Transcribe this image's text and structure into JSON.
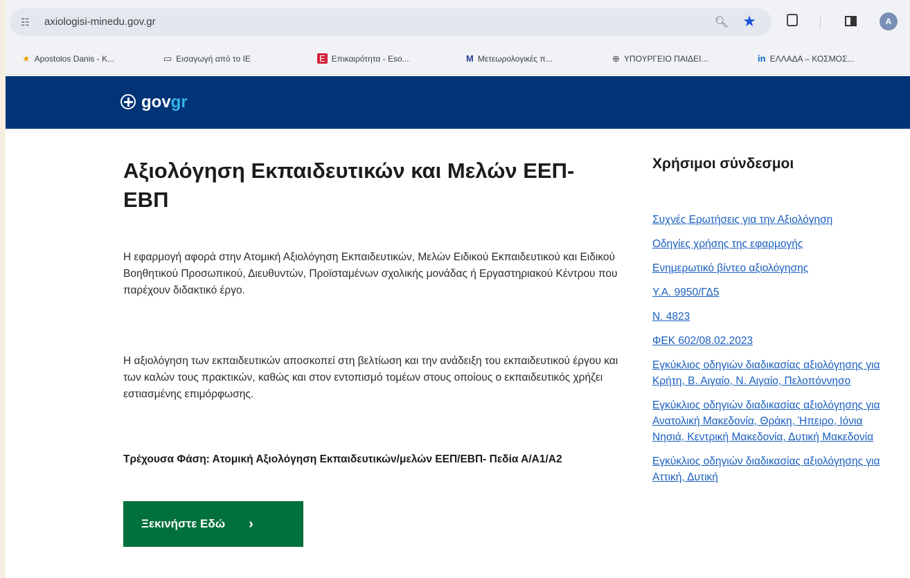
{
  "browser": {
    "url": "axiologisi-minedu.gov.gr",
    "profile_initial": "A",
    "bookmarks": [
      {
        "label": "Apostolos Danis - K...",
        "icon": "star-icon"
      },
      {
        "label": "Εισαγωγή από το IE",
        "icon": "folder-icon"
      },
      {
        "label": "Επικαιρότητα - Eso...",
        "icon": "eso-icon"
      },
      {
        "label": "Μετεωρολογικές π...",
        "icon": "meteo-icon"
      },
      {
        "label": "ΥΠΟΥΡΓΕΙΟ ΠΑΙΔΕΙ...",
        "icon": "ministry-icon"
      },
      {
        "label": "ΕΛΛΑΔΑ – ΚΟΣΜΟΣ...",
        "icon": "linkedin-icon"
      }
    ]
  },
  "header": {
    "logo_text_a": "gov",
    "logo_text_b": "gr"
  },
  "main": {
    "title": "Αξιολόγηση Εκπαιδευτικών και Μελών ΕΕΠ-ΕΒΠ",
    "paragraph1": "Η εφαρμογή αφορά στην Ατομική Αξιολόγηση Εκπαιδευτικών, Μελών Ειδικού Εκπαιδευτικού και Ειδικού Βοηθητικού Προσωπικού, Διευθυντών, Προϊσταμένων σχολικής μονάδας ή Εργαστηριακού Κέντρου που παρέχουν διδακτικό έργο.",
    "paragraph2": "Η αξιολόγηση των εκπαιδευτικών αποσκοπεί στη βελτίωση και την ανάδειξη του εκπαιδευτικού έργου και των καλών τους πρακτικών, καθώς και στον εντοπισμό τομέων στους οποίους ο εκπαιδευτικός χρήζει εστιασμένης επιμόρφωσης.",
    "phase": "Τρέχουσα Φάση: Ατομική Αξιολόγηση Εκπαιδευτικών/μελών ΕΕΠ/ΕΒΠ- Πεδία Α/Α1/Α2",
    "start_button": "Ξεκινήστε Εδώ",
    "start_chevron": "›"
  },
  "sidebar": {
    "title": "Χρήσιμοι σύνδεσμοι",
    "links": [
      "Συχνές Ερωτήσεις για την Αξιολόγηση",
      "Οδηγίες χρήσης της εφαρμογής",
      "Ενημερωτικό βίντεο αξιολόγησης",
      "Υ.Α. 9950/ΓΔ5",
      "Ν. 4823",
      "ΦΕΚ 602/08.02.2023",
      "Εγκύκλιος οδηγιών διαδικασίας αξιολόγησης για Κρήτη, Β. Αιγαίο, Ν. Αιγαίο, Πελοπόννησο",
      "Εγκύκλιος οδηγιών διαδικασίας αξιολόγησης για Ανατολική Μακεδονία, Θράκη, Ήπειρο, Ιόνια Νησιά, Κεντρική Μακεδονία, Δυτική Μακεδονία",
      "Εγκύκλιος οδηγιών διαδικασίας αξιολόγησης για Αττική, Δυτική"
    ]
  },
  "colors": {
    "gov_blue": "#003476",
    "button_green": "#00703c",
    "link_blue": "#1a5fbf"
  }
}
